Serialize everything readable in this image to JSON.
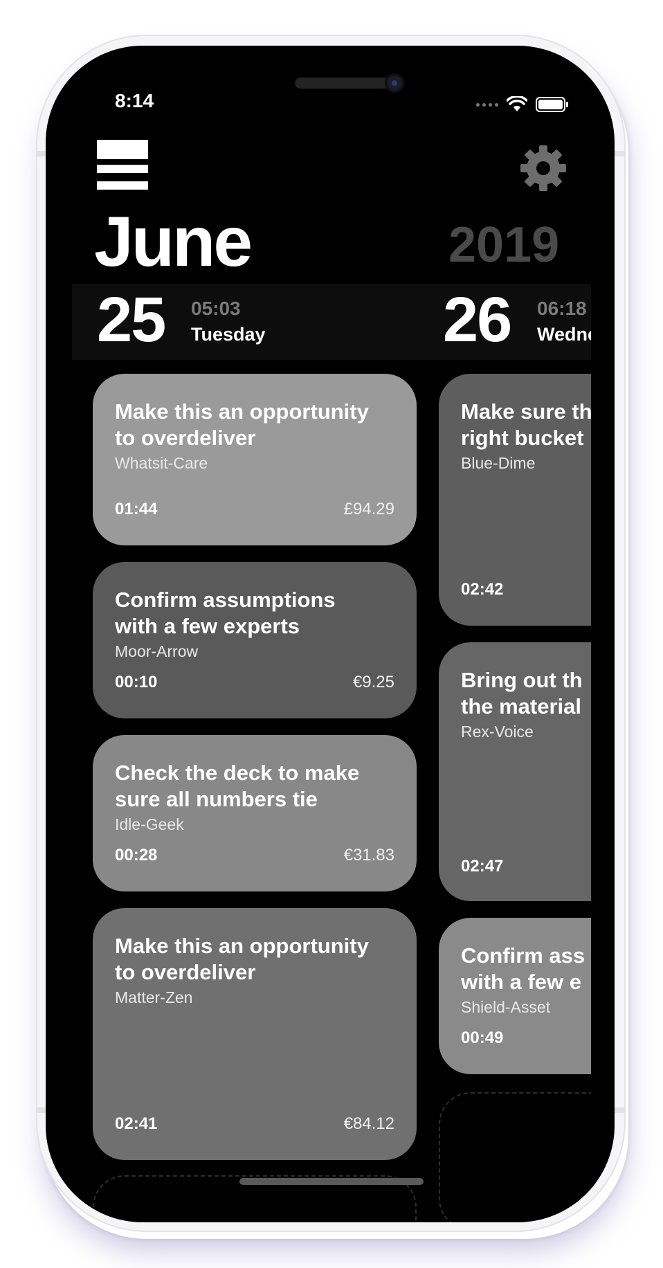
{
  "status_bar": {
    "time": "8:14"
  },
  "header": {
    "month": "June",
    "year": "2019"
  },
  "days": [
    {
      "day": "25",
      "time": "05:03",
      "weekday": "Tuesday"
    },
    {
      "day": "26",
      "time": "06:18",
      "weekday": "Wednesday"
    }
  ],
  "column1": [
    {
      "title1": "Make this an opportunity",
      "title2": "to overdeliver",
      "client": "Whatsit-Care",
      "duration": "01:44",
      "price": "£94.29",
      "color": "#9a9a9a"
    },
    {
      "title1": "Confirm assumptions",
      "title2": "with a few experts",
      "client": "Moor-Arrow",
      "duration": "00:10",
      "price": "€9.25",
      "color": "#5a5a5a"
    },
    {
      "title1": "Check the deck to make",
      "title2": "sure all numbers tie",
      "client": "Idle-Geek",
      "duration": "00:28",
      "price": "€31.83",
      "color": "#888888"
    },
    {
      "title1": "Make this an opportunity",
      "title2": "to overdeliver",
      "client": "Matter-Zen",
      "duration": "02:41",
      "price": "€84.12",
      "color": "#707070"
    }
  ],
  "column2": [
    {
      "title1": "Make sure th",
      "title2": "right bucket",
      "client": "Blue-Dime",
      "duration": "02:42",
      "color": "#5e5e5e"
    },
    {
      "title1": "Bring out th",
      "title2": "the material",
      "client": "Rex-Voice",
      "duration": "02:47",
      "color": "#666666"
    },
    {
      "title1": "Confirm ass",
      "title2": "with a few e",
      "client": "Shield-Asset",
      "duration": "00:49",
      "color": "#8a8a8a"
    }
  ],
  "icons": {
    "menu": "menu-icon",
    "settings": "gear-icon",
    "wifi": "wifi-icon",
    "battery": "battery-icon"
  }
}
